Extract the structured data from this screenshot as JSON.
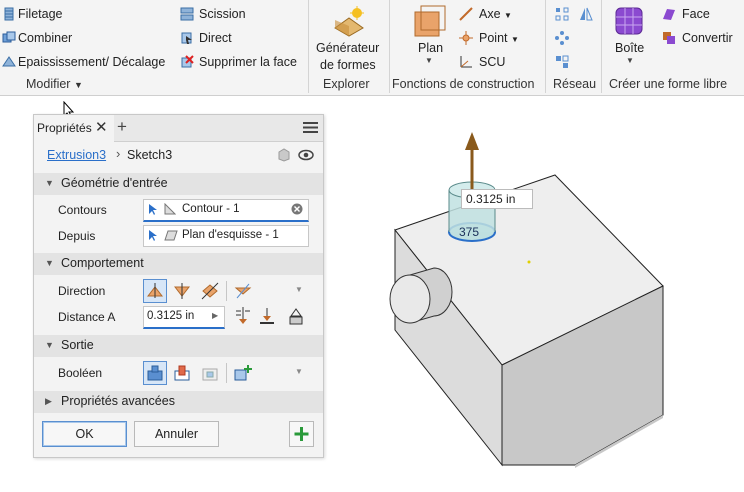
{
  "ribbon": {
    "modifier": {
      "items": [
        "Filetage",
        "Combiner",
        "Epaississement/ Décalage",
        "Scission",
        "Direct",
        "Supprimer la face"
      ],
      "group_label": "Modifier"
    },
    "explorer": {
      "button_label_line1": "Générateur",
      "button_label_line2": "de formes",
      "group_label": "Explorer"
    },
    "construction": {
      "plan_label": "Plan",
      "axe_label": "Axe",
      "point_label": "Point",
      "scu_label": "SCU",
      "group_label": "Fonctions de construction"
    },
    "reseau": {
      "group_label": "Réseau"
    },
    "forme_libre": {
      "boite_label": "Boîte",
      "face_label": "Face",
      "convertir_label": "Convertir",
      "group_label": "Créer une forme libre"
    }
  },
  "panel": {
    "tab_label": "Propriétés",
    "breadcrumb": {
      "feature": "Extrusion3",
      "sketch": "Sketch3"
    },
    "sections": {
      "geometry": "Géométrie d'entrée",
      "behavior": "Comportement",
      "output": "Sortie",
      "advanced": "Propriétés avancées"
    },
    "fields": {
      "contours_label": "Contours",
      "contours_value": "Contour - 1",
      "depuis_label": "Depuis",
      "depuis_value": "Plan d'esquisse - 1",
      "direction_label": "Direction",
      "distance_label": "Distance A",
      "distance_value": "0.3125 in",
      "boolean_label": "Booléen"
    },
    "buttons": {
      "ok": "OK",
      "cancel": "Annuler"
    }
  },
  "viewport": {
    "dimension_input": "0.3125 in",
    "dimension_partial": "375"
  },
  "colors": {
    "accent": "#2a6fc9",
    "arrow": "#8a5a1c",
    "preview": "#bfe0e0"
  }
}
